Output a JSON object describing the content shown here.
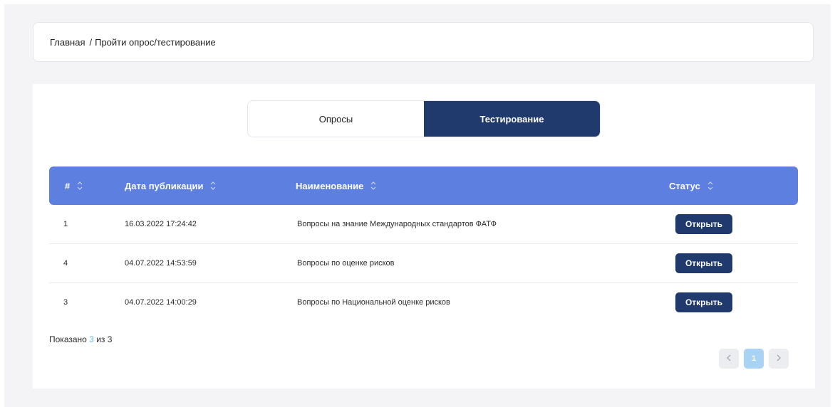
{
  "breadcrumb": {
    "home": "Главная",
    "separator": "/",
    "current": "Пройти опрос/тестирование"
  },
  "tabs": [
    {
      "label": "Опросы",
      "active": false
    },
    {
      "label": "Тестирование",
      "active": true
    }
  ],
  "table": {
    "columns": {
      "num": "#",
      "date": "Дата публикации",
      "name": "Наименование",
      "status": "Статус"
    },
    "rows": [
      {
        "num": "1",
        "date": "16.03.2022 17:24:42",
        "name": "Вопросы на знание Международных стандартов ФАТФ",
        "action": "Открыть"
      },
      {
        "num": "4",
        "date": "04.07.2022 14:53:59",
        "name": "Вопросы по оценке рисков",
        "action": "Открыть"
      },
      {
        "num": "3",
        "date": "04.07.2022 14:00:29",
        "name": "Вопросы по Национальной оценке рисков",
        "action": "Открыть"
      }
    ]
  },
  "footer": {
    "shown_prefix": "Показано",
    "shown_count": "3",
    "of_text": "из",
    "total": "3"
  },
  "pagination": {
    "prev_icon": "chevron-left-icon",
    "current_page": "1",
    "next_icon": "chevron-right-icon"
  },
  "colors": {
    "header_bg": "#5c7fe0",
    "accent_dark": "#213a6e",
    "page_active": "#a9d3f5",
    "count_highlight": "#5cc0e8"
  }
}
